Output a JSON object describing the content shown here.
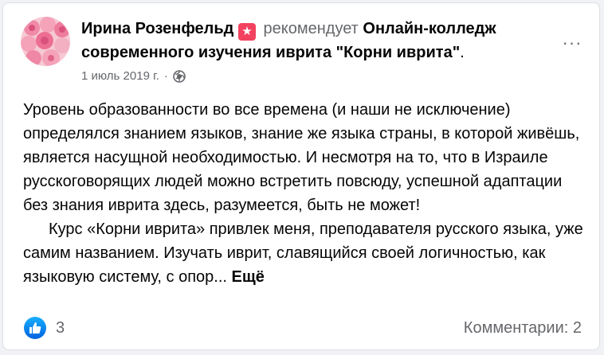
{
  "post": {
    "author": "Ирина Розенфельд",
    "action": "рекомендует",
    "page_name": "Онлайн-колледж современного изучения иврита \"Корни иврита\"",
    "period": ".",
    "date": "1 июль 2019 г.",
    "dot": "·",
    "menu_icon": "more-horizontal-icon",
    "body": {
      "paragraph_1": "Уровень образованности во все времена (и наши не исключение) определялся знанием языков, знание же языка страны, в которой живёшь, является насущной необходимостью. И несмотря на то, что  в Израиле русскоговорящих людей можно встретить повсюду, успешной адаптации без знания иврита здесь, разумеется, быть не может!",
      "paragraph_2": "Курс «Корни иврита» привлек меня, преподавателя русского языка, уже самим названием. Изучать иврит, славящийся своей логичностью, как языковую систему, с опор...",
      "see_more": "Ещё"
    },
    "footer": {
      "likes_count": "3",
      "comments": "Комментарии: 2"
    }
  },
  "colors": {
    "recommend_badge": "#f3425f",
    "like_blue": "#1877f2",
    "muted_text": "#65676b"
  }
}
